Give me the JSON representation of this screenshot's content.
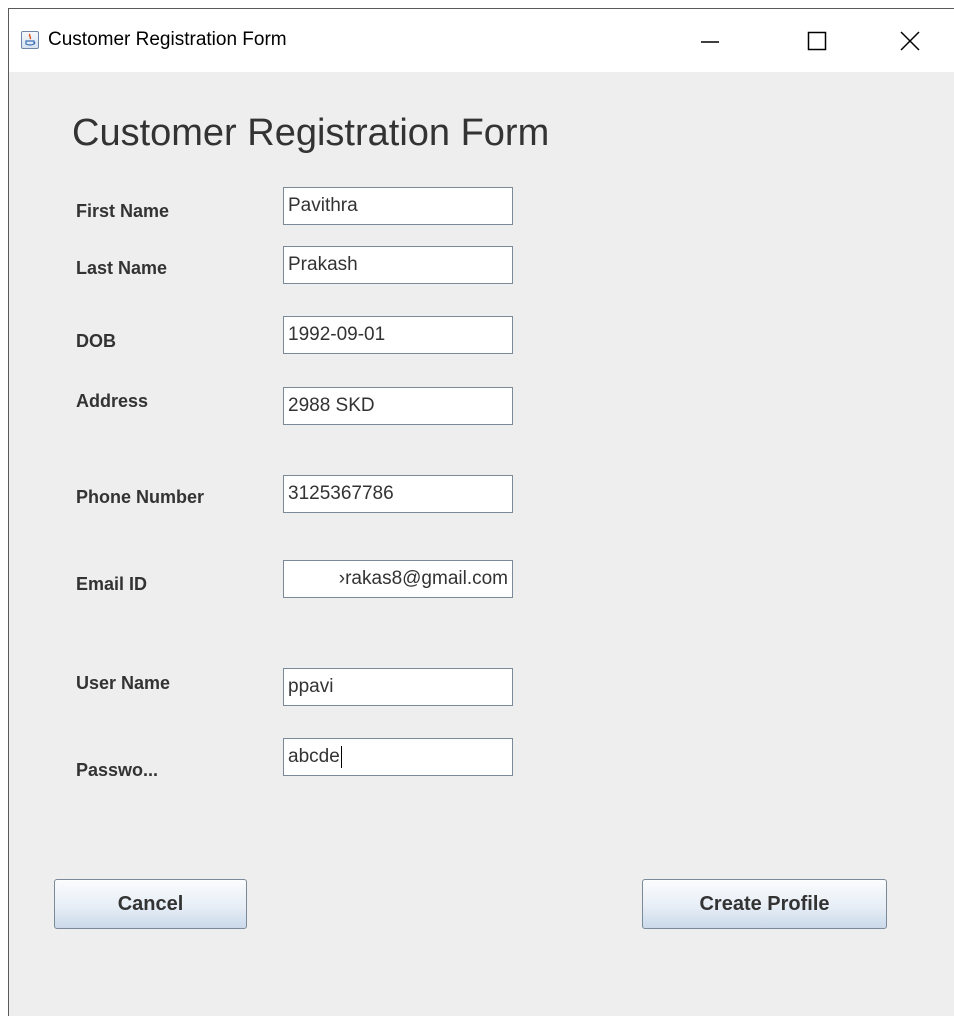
{
  "window": {
    "title": "Customer Registration Form",
    "icons": {
      "app": "java-app-icon",
      "minimize": "minimize-icon",
      "maximize": "maximize-icon",
      "close": "close-icon"
    }
  },
  "form": {
    "heading": "Customer Registration Form",
    "fields": {
      "first_name": {
        "label": "First Name",
        "value": "Pavithra"
      },
      "last_name": {
        "label": "Last Name",
        "value": "Prakash"
      },
      "dob": {
        "label": "DOB",
        "value": "1992-09-01"
      },
      "address": {
        "label": "Address",
        "value": "2988 SKD"
      },
      "phone": {
        "label": "Phone Number",
        "value": "3125367786"
      },
      "email": {
        "label": "Email ID",
        "value": "›rakas8@gmail.com"
      },
      "username": {
        "label": "User Name",
        "value": "ppavi"
      },
      "password": {
        "label": "Passwo...",
        "value": "abcde"
      }
    },
    "buttons": {
      "cancel": "Cancel",
      "create": "Create Profile"
    }
  }
}
